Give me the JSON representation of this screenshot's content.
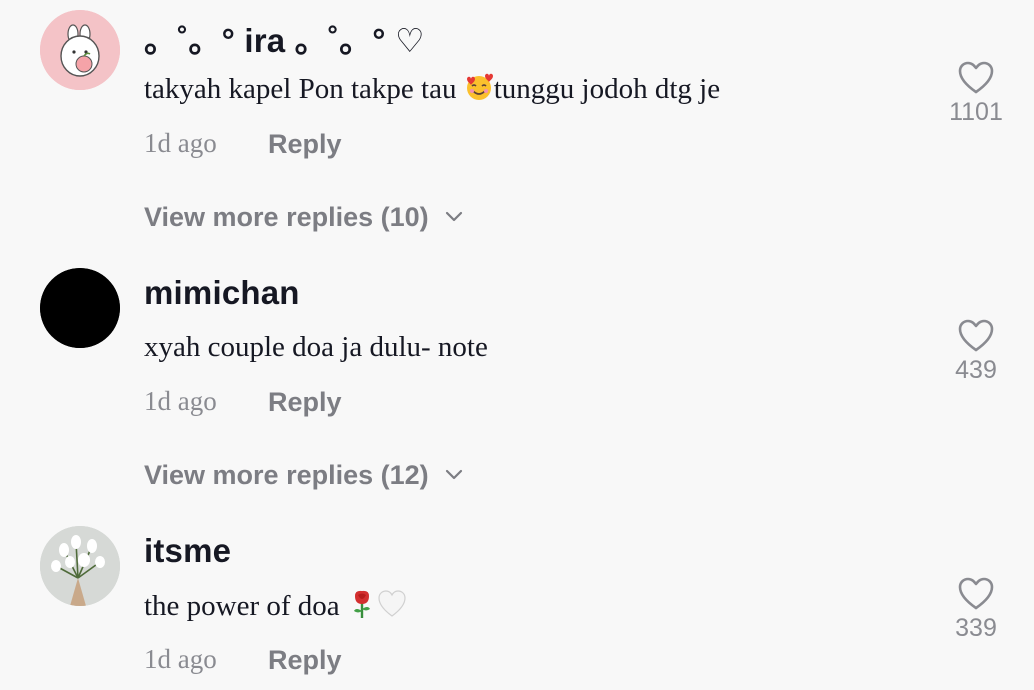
{
  "comments": [
    {
      "username": "。˚。° ira 。˚。° ♡",
      "text_before": "takyah kapel Pon takpe tau ",
      "text_after": "tunggu jodoh dtg je",
      "time": "1d ago",
      "reply_label": "Reply",
      "likes": "1101",
      "view_more": "View more replies (10)",
      "avatar_icon": "bunny-avatar-icon"
    },
    {
      "username": "mimichan",
      "text": "xyah couple doa ja dulu- note",
      "time": "1d ago",
      "reply_label": "Reply",
      "likes": "439",
      "view_more": "View more replies (12)",
      "avatar_icon": "black-avatar"
    },
    {
      "username": "itsme",
      "text": "the power of doa ",
      "time": "1d ago",
      "reply_label": "Reply",
      "likes": "339",
      "avatar_icon": "flower-bouquet-avatar"
    }
  ],
  "colors": {
    "background": "#f8f8f8",
    "primary_text": "#161823",
    "secondary_text": "#8a8b91",
    "avatar_pink": "#f4c3c7"
  }
}
